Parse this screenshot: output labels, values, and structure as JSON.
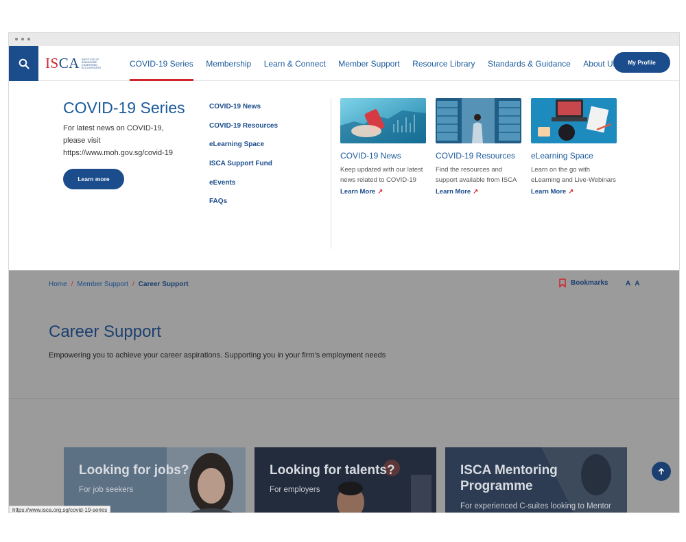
{
  "logo": {
    "text_part1": "IS",
    "text_part2": "CA",
    "subtitle": "Institute of Singapore Chartered Accountants"
  },
  "nav": {
    "items": [
      {
        "label": "COVID-19 Series",
        "active": true
      },
      {
        "label": "Membership"
      },
      {
        "label": "Learn & Connect"
      },
      {
        "label": "Member Support"
      },
      {
        "label": "Resource Library"
      },
      {
        "label": "Standards & Guidance"
      },
      {
        "label": "About Us"
      }
    ],
    "profile_label": "My Profile"
  },
  "mega_menu": {
    "title": "COVID-19 Series",
    "description": "For latest news on COVID-19, please visit https://www.moh.gov.sg/covid-19",
    "button_label": "Learn more",
    "links": [
      "COVID-19 News",
      "COVID-19 Resources",
      "eLearning Space",
      "ISCA Support Fund",
      "eEvents",
      "FAQs"
    ],
    "cards": [
      {
        "title": "COVID-19 News",
        "description": "Keep updated with our latest news related to COVID-19",
        "more": "Learn More",
        "arrow": "↗"
      },
      {
        "title": "COVID-19 Resources",
        "description": "Find the resources and support available from ISCA",
        "more": "Learn More",
        "arrow": "↗"
      },
      {
        "title": "eLearning Space",
        "description": "Learn on the go with eLearning and Live-Webinars",
        "more": "Learn More",
        "arrow": "↗"
      }
    ]
  },
  "page": {
    "breadcrumb": [
      "Home",
      "Member Support",
      "Career Support"
    ],
    "breadcrumb_sep": "/",
    "bookmarks_label": "Bookmarks",
    "font_small": "A",
    "font_large": "A",
    "title": "Career Support",
    "subtitle": "Empowering you to achieve your career aspirations. Supporting you in your firm's employment needs",
    "tiles": [
      {
        "title": "Looking for jobs?",
        "subtitle": "For job seekers"
      },
      {
        "title": "Looking for talents?",
        "subtitle": "For employers"
      },
      {
        "title": "ISCA Mentoring Programme",
        "subtitle": "For experienced C-suites looking to Mentor"
      }
    ]
  },
  "status_bar_url": "https://www.isca.org.sg/covid-19-series",
  "colors": {
    "brand_blue": "#1b4c8c",
    "accent_red": "#d2232a",
    "link_blue": "#1b5a9b"
  },
  "icons": {
    "search": "search-icon",
    "bookmark": "bookmark-icon",
    "back_to_top": "arrow-up-icon"
  }
}
